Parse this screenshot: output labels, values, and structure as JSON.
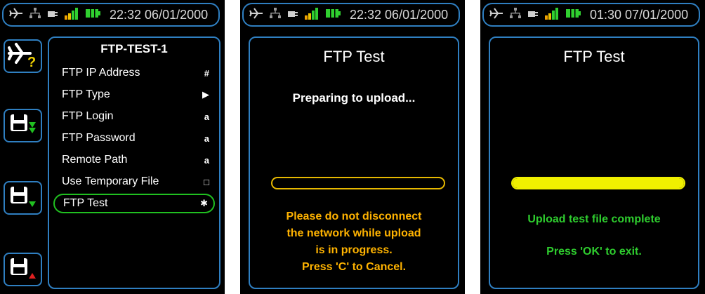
{
  "colors": {
    "border_blue": "#2f7fc1",
    "warning_orange": "#ffb300",
    "success_green": "#2ecc2e",
    "progress_yellow": "#f0f000",
    "selection_green": "#20c020"
  },
  "screens": [
    {
      "status": {
        "time": "22:32 06/01/2000",
        "icons": [
          "airplane-icon",
          "network-icon",
          "plug-icon",
          "signal-bars-icon",
          "battery-icon"
        ]
      },
      "side_buttons": [
        {
          "icon": "airplane-help-icon"
        },
        {
          "icon": "save-download-icon"
        },
        {
          "icon": "save-download-single-icon"
        },
        {
          "icon": "save-upload-icon"
        }
      ],
      "menu": {
        "title": "FTP-TEST-1",
        "items": [
          {
            "label": "FTP IP Address",
            "indicator": "#"
          },
          {
            "label": "FTP Type",
            "indicator": "▶"
          },
          {
            "label": "FTP Login",
            "indicator": "a"
          },
          {
            "label": "FTP Password",
            "indicator": "a"
          },
          {
            "label": "Remote Path",
            "indicator": "a"
          },
          {
            "label": "Use Temporary File",
            "indicator": "□"
          },
          {
            "label": "FTP Test",
            "indicator": "✱"
          }
        ],
        "selected_index": 6
      }
    },
    {
      "status": {
        "time": "22:32 06/01/2000"
      },
      "title": "FTP Test",
      "message": "Preparing to upload...",
      "progress": 0.0,
      "warning_lines": [
        "Please do not disconnect",
        "the network while upload",
        "is in progress.",
        "Press 'C' to Cancel."
      ]
    },
    {
      "status": {
        "time": "01:30 07/01/2000"
      },
      "title": "FTP Test",
      "progress": 1.0,
      "complete_message": "Upload test file complete",
      "exit_message": "Press 'OK' to exit."
    }
  ]
}
